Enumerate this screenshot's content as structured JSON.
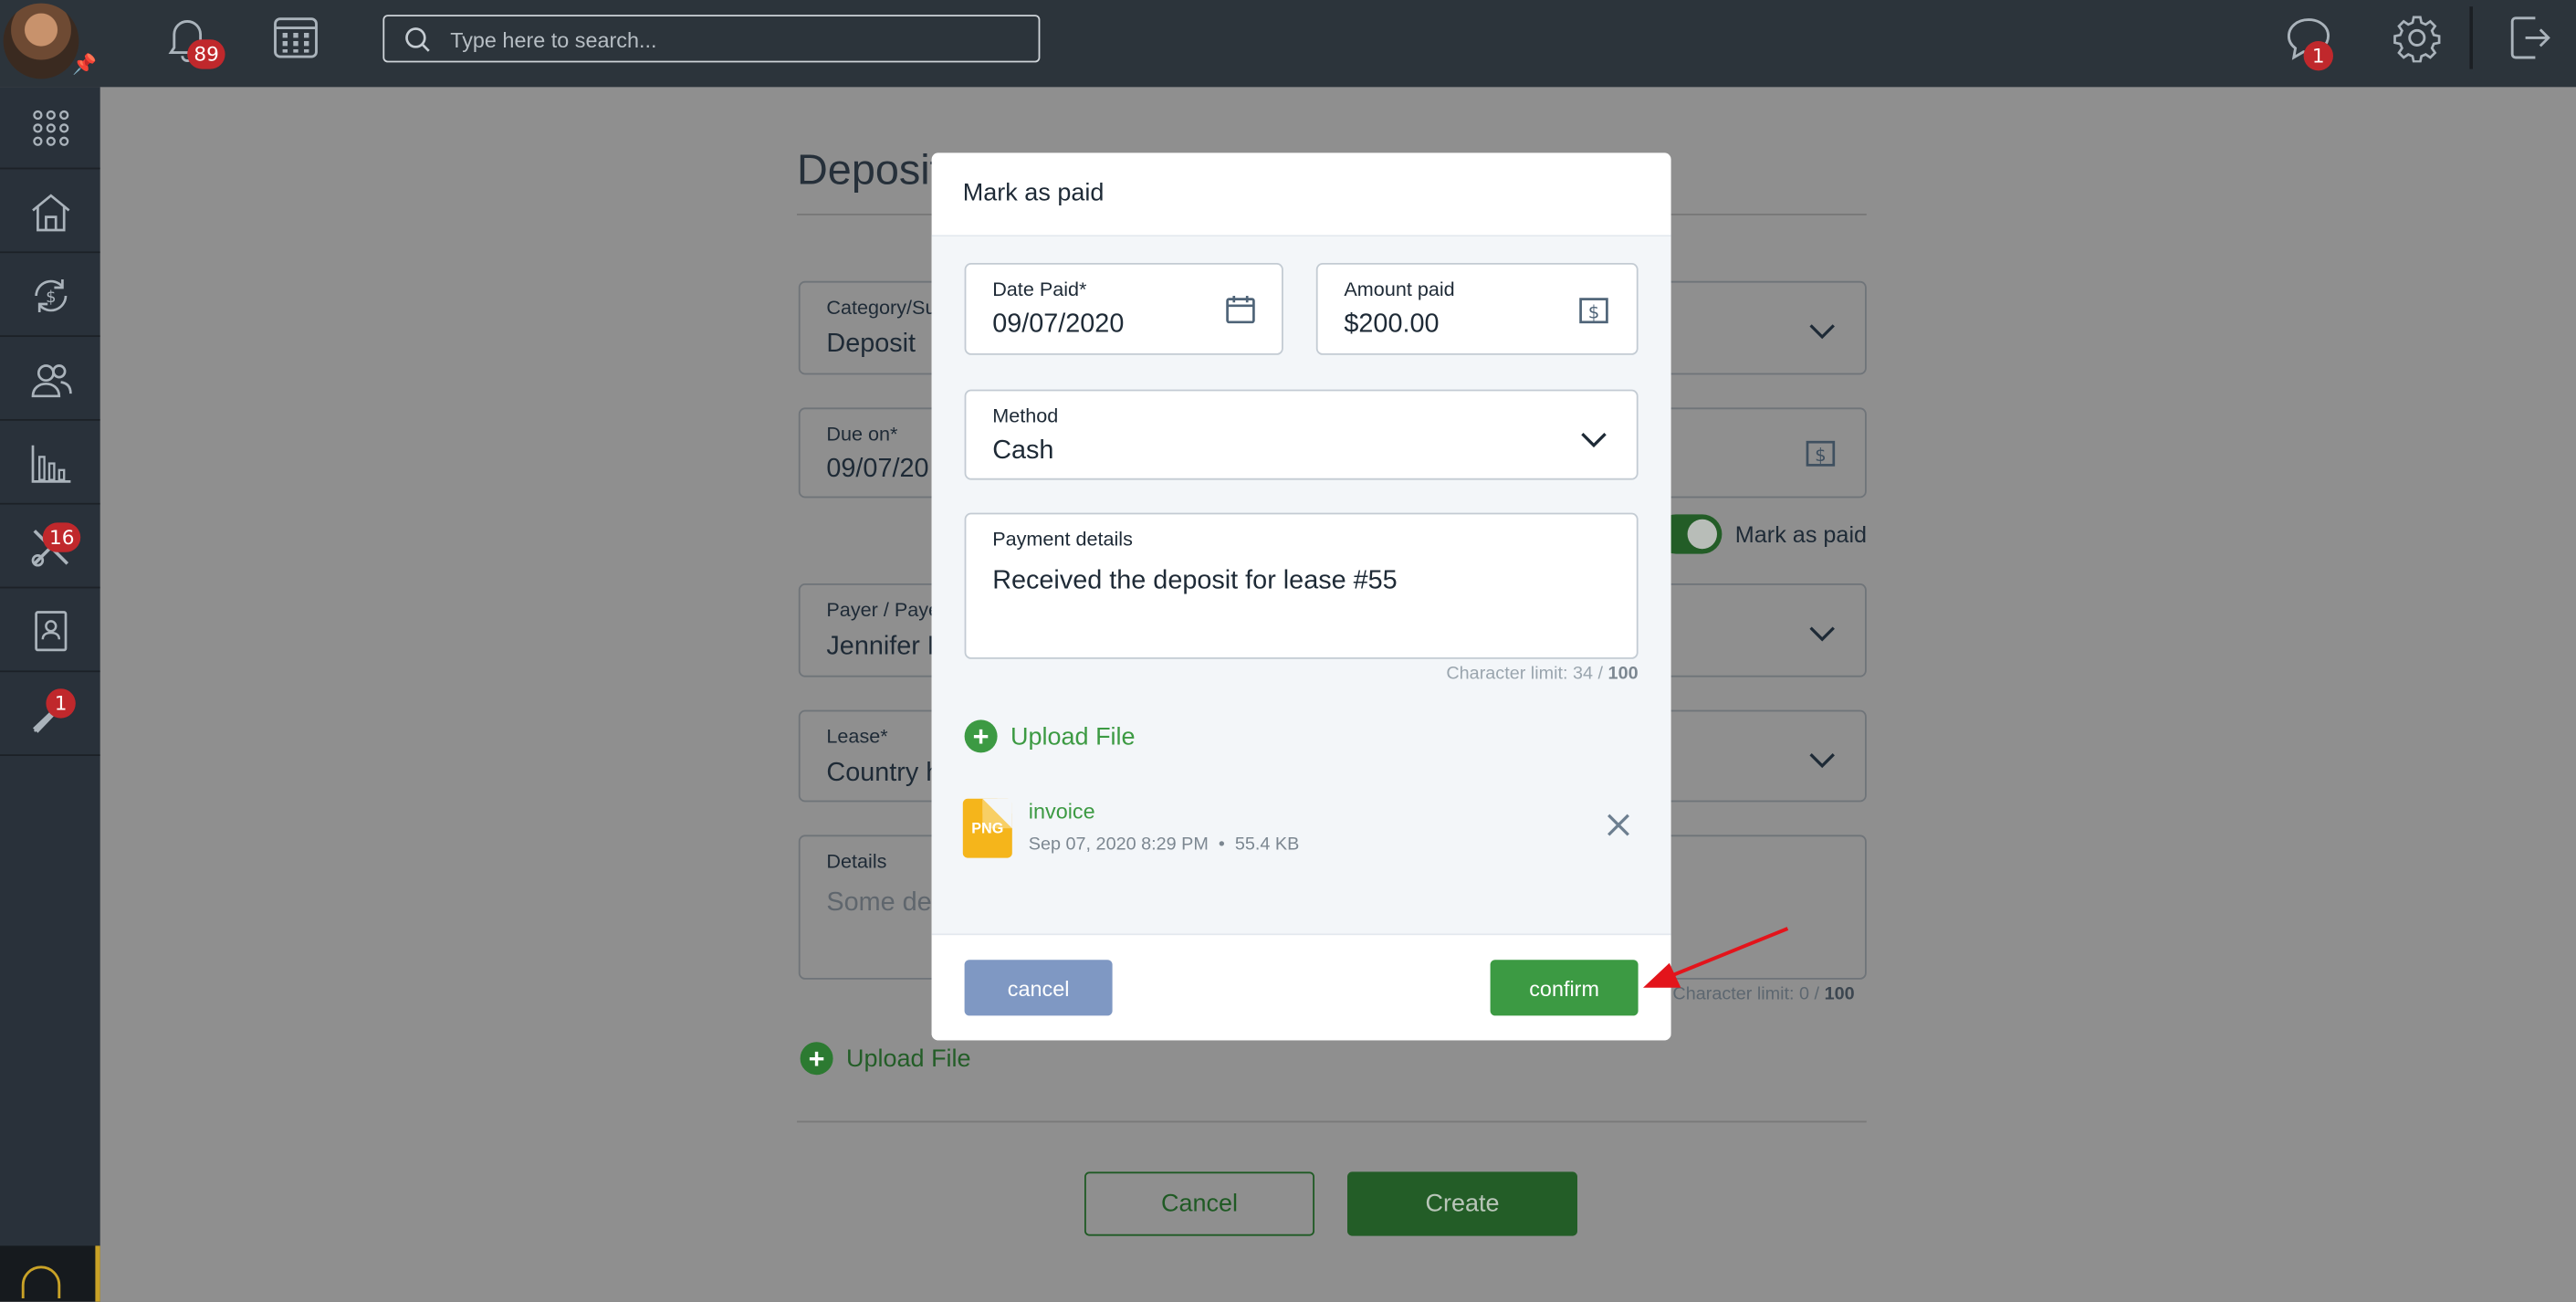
{
  "topbar": {
    "notifications_count": "89",
    "search_placeholder": "Type here to search...",
    "messages_count": "1"
  },
  "sidebar": {
    "maintenance_badge": "16",
    "tools_badge": "1"
  },
  "background_form": {
    "title": "Deposit",
    "category_label": "Category/Su",
    "category_value": "Deposit",
    "due_label": "Due on*",
    "due_value": "09/07/20",
    "mark_as_paid_label": "Mark as paid",
    "payer_label": "Payer / Paye",
    "payer_value": "Jennifer F",
    "lease_label": "Lease*",
    "lease_value": "Country h",
    "details_label": "Details",
    "details_placeholder": "Some de",
    "char_limit_text": "Character limit: 0 /",
    "char_limit_max": "100",
    "upload_label": "Upload File",
    "cancel_label": "Cancel",
    "create_label": "Create"
  },
  "modal": {
    "title": "Mark as paid",
    "date_paid_label": "Date Paid*",
    "date_paid_value": "09/07/2020",
    "amount_label": "Amount paid",
    "amount_value": "$200.00",
    "method_label": "Method",
    "method_value": "Cash",
    "payment_details_label": "Payment details",
    "payment_details_value": "Received the deposit for lease #55",
    "char_limit_text": "Character limit: 34 /",
    "char_limit_max": "100",
    "upload_label": "Upload File",
    "file": {
      "type": "PNG",
      "name": "invoice",
      "date": "Sep 07, 2020 8:29 PM",
      "separator": "•",
      "size": "55.4 KB"
    },
    "cancel_label": "cancel",
    "confirm_label": "confirm"
  },
  "colors": {
    "accent_green": "#3c9a43",
    "cancel_blue": "#7f98c3",
    "topbar": "#2c343b",
    "badge_red": "#c0282c",
    "file_icon_yellow": "#f5b51b",
    "annotation_arrow": "#e3141b"
  }
}
